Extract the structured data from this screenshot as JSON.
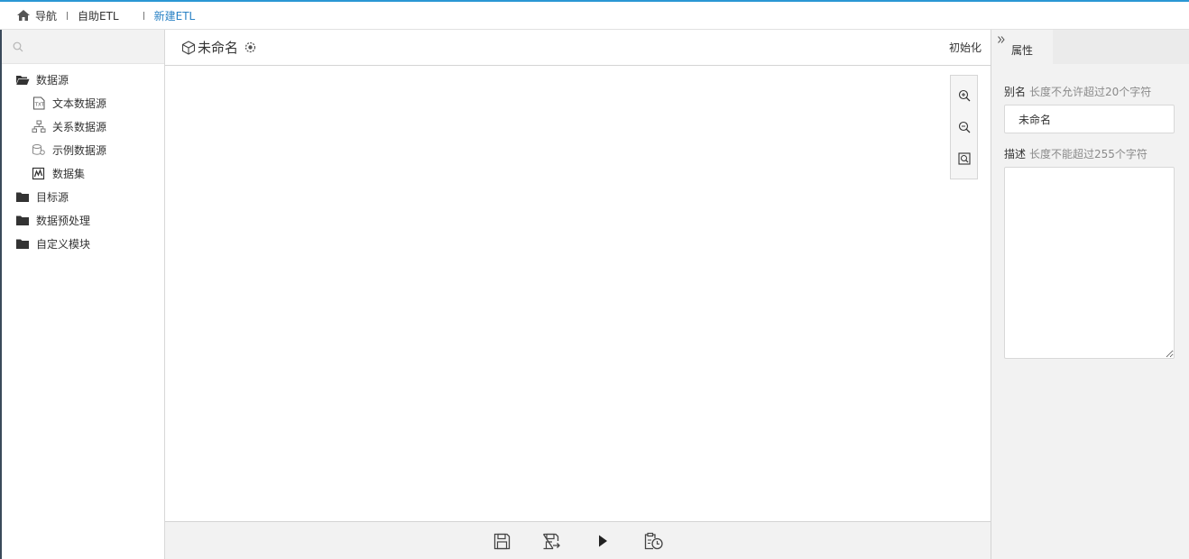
{
  "breadcrumb": {
    "nav": "导航",
    "self_etl": "自助ETL",
    "current": "新建ETL"
  },
  "sidebar": {
    "search_placeholder": "",
    "datasource": {
      "label": "数据源",
      "children": [
        {
          "label": "文本数据源",
          "icon": "text-datasource-icon"
        },
        {
          "label": "关系数据源",
          "icon": "relation-datasource-icon"
        },
        {
          "label": "示例数据源",
          "icon": "sample-datasource-icon"
        },
        {
          "label": "数据集",
          "icon": "dataset-icon"
        }
      ]
    },
    "target": "目标源",
    "preprocess": "数据预处理",
    "custom": "自定义模块"
  },
  "editor": {
    "title": "未命名",
    "init_label": "初始化"
  },
  "properties": {
    "tab_label": "属性",
    "alias_label": "别名",
    "alias_hint": "长度不允许超过20个字符",
    "alias_value": "未命名",
    "desc_label": "描述",
    "desc_hint": "长度不能超过255个字符",
    "desc_value": ""
  },
  "colors": {
    "accent": "#2a97d4",
    "active_crumb": "#2a82c5"
  }
}
